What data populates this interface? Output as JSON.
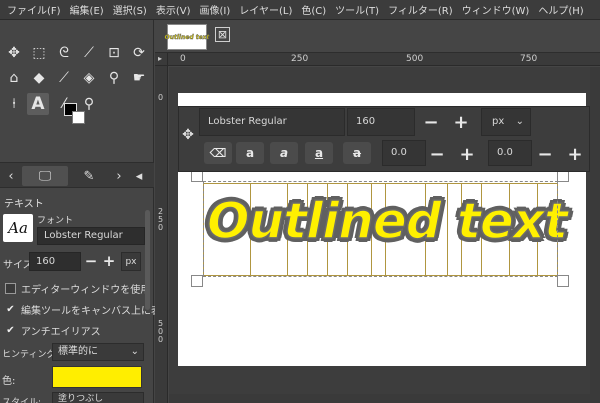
{
  "menu": [
    "ファイル(F)",
    "編集(E)",
    "選択(S)",
    "表示(V)",
    "画像(I)",
    "レイヤー(L)",
    "色(C)",
    "ツール(T)",
    "フィルター(R)",
    "ウィンドウ(W)",
    "ヘルプ(H)"
  ],
  "image_tab": {
    "thumbnail_text": "Outlined text",
    "close_glyph": "⊠"
  },
  "ruler": {
    "top": [
      "0",
      "250",
      "500",
      "750"
    ],
    "left": [
      "0",
      "2 5 0",
      "5 0 0"
    ]
  },
  "editor": {
    "font_name": "Lobster Regular",
    "size": "160",
    "unit": "px",
    "baseline": "0.0",
    "kerning": "0.0"
  },
  "tool_options": {
    "title": "テキスト",
    "font_label": "フォント",
    "font_preview": "Aa",
    "font_value": "Lobster Regular",
    "size_label": "サイズ:",
    "size_value": "160",
    "unit": "px",
    "use_editor": "エディターウィンドウを使用",
    "use_editor_checked": false,
    "on_canvas": "編集ツールをキャンバス上に表",
    "on_canvas_checked": true,
    "antialias": "アンチエイリアス",
    "antialias_checked": true,
    "hinting_label": "ヒンティング:",
    "hinting_value": "標準的に",
    "color_label": "色:",
    "color_value": "#ffee00",
    "style_label": "スタイル:",
    "style_value": "塗りつぶし"
  },
  "canvas": {
    "text": "Outlined text",
    "text_color": "#fff000",
    "outline_color": "#606060"
  },
  "accent": "#ffee00"
}
